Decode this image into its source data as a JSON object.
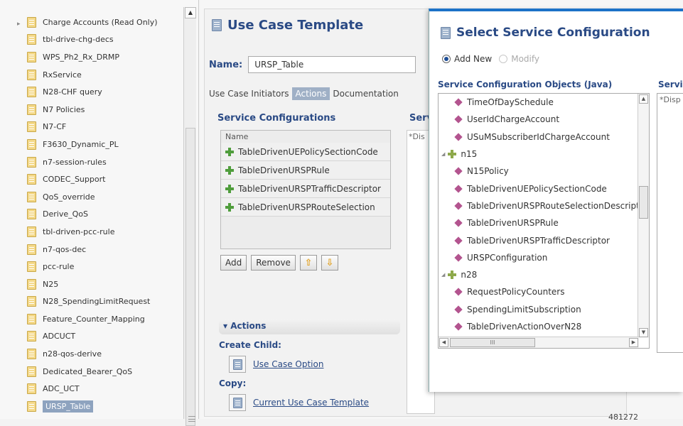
{
  "tree": {
    "items": [
      {
        "label": "Charge Accounts (Read Only)",
        "expandable": true
      },
      {
        "label": "tbl-drive-chg-decs"
      },
      {
        "label": "WPS_Ph2_Rx_DRMP"
      },
      {
        "label": "RxService"
      },
      {
        "label": "N28-CHF query"
      },
      {
        "label": "N7 Policies"
      },
      {
        "label": "N7-CF"
      },
      {
        "label": "F3630_Dynamic_PL"
      },
      {
        "label": "n7-session-rules"
      },
      {
        "label": "CODEC_Support"
      },
      {
        "label": "QoS_override"
      },
      {
        "label": "Derive_QoS"
      },
      {
        "label": "tbl-driven-pcc-rule"
      },
      {
        "label": "n7-qos-dec"
      },
      {
        "label": "pcc-rule"
      },
      {
        "label": "N25"
      },
      {
        "label": "N28_SpendingLimitRequest"
      },
      {
        "label": "Feature_Counter_Mapping"
      },
      {
        "label": "ADCUCT"
      },
      {
        "label": "n28-qos-derive"
      },
      {
        "label": "Dedicated_Bearer_QoS"
      },
      {
        "label": "ADC_UCT"
      },
      {
        "label": "URSP_Table",
        "selected": true
      }
    ]
  },
  "template": {
    "title": "Use Case Template",
    "name_label": "Name:",
    "name_value": "URSP_Table",
    "tabs": [
      "Use Case Initiators",
      "Actions",
      "Documentation"
    ],
    "active_tab": "Actions",
    "service_config_heading": "Service Configurations",
    "service_config_col2_heading": "Serv",
    "col2_placeholder": "*Dis",
    "list_header": "Name",
    "service_configs": [
      "TableDrivenUEPolicySectionCode",
      "TableDrivenURSPRule",
      "TableDrivenURSPTrafficDescriptor",
      "TableDrivenURSPRouteSelection"
    ],
    "buttons": {
      "add": "Add",
      "remove": "Remove",
      "up_icon": "arrow-up-icon",
      "down_icon": "arrow-down-icon"
    },
    "actions": {
      "header": "▾ Actions",
      "create_child_label": "Create Child:",
      "create_child_link": "Use Case Option",
      "copy_label": "Copy:",
      "copy_link": "Current Use Case Template"
    },
    "footer_number": "481272"
  },
  "dialog": {
    "title": "Select Service Configuration",
    "radio_add": "Add New",
    "radio_modify": "Modify",
    "objects_heading": "Service Configuration Objects (Java)",
    "serv_heading": "Servi",
    "serv_placeholder": "*Disp",
    "tree_nodes": [
      {
        "label": "TimeOfDaySchedule",
        "level": 1
      },
      {
        "label": "UserIdChargeAccount",
        "level": 1
      },
      {
        "label": "USuMSubscriberIdChargeAccount",
        "level": 1
      },
      {
        "label": "n15",
        "level": 0
      },
      {
        "label": "N15Policy",
        "level": 1
      },
      {
        "label": "TableDrivenUEPolicySectionCode",
        "level": 1
      },
      {
        "label": "TableDrivenURSPRouteSelectionDescriptor",
        "level": 1
      },
      {
        "label": "TableDrivenURSPRule",
        "level": 1
      },
      {
        "label": "TableDrivenURSPTrafficDescriptor",
        "level": 1
      },
      {
        "label": "URSPConfiguration",
        "level": 1
      },
      {
        "label": "n28",
        "level": 0
      },
      {
        "label": "RequestPolicyCounters",
        "level": 1
      },
      {
        "label": "SpendingLimitSubscription",
        "level": 1
      },
      {
        "label": "TableDrivenActionOverN28",
        "level": 1
      }
    ],
    "hscroll_glyph": "III"
  },
  "colors": {
    "accent": "#2a4a85",
    "dialog_border": "#1c72c8",
    "selected_bg": "#8ea3bf"
  }
}
